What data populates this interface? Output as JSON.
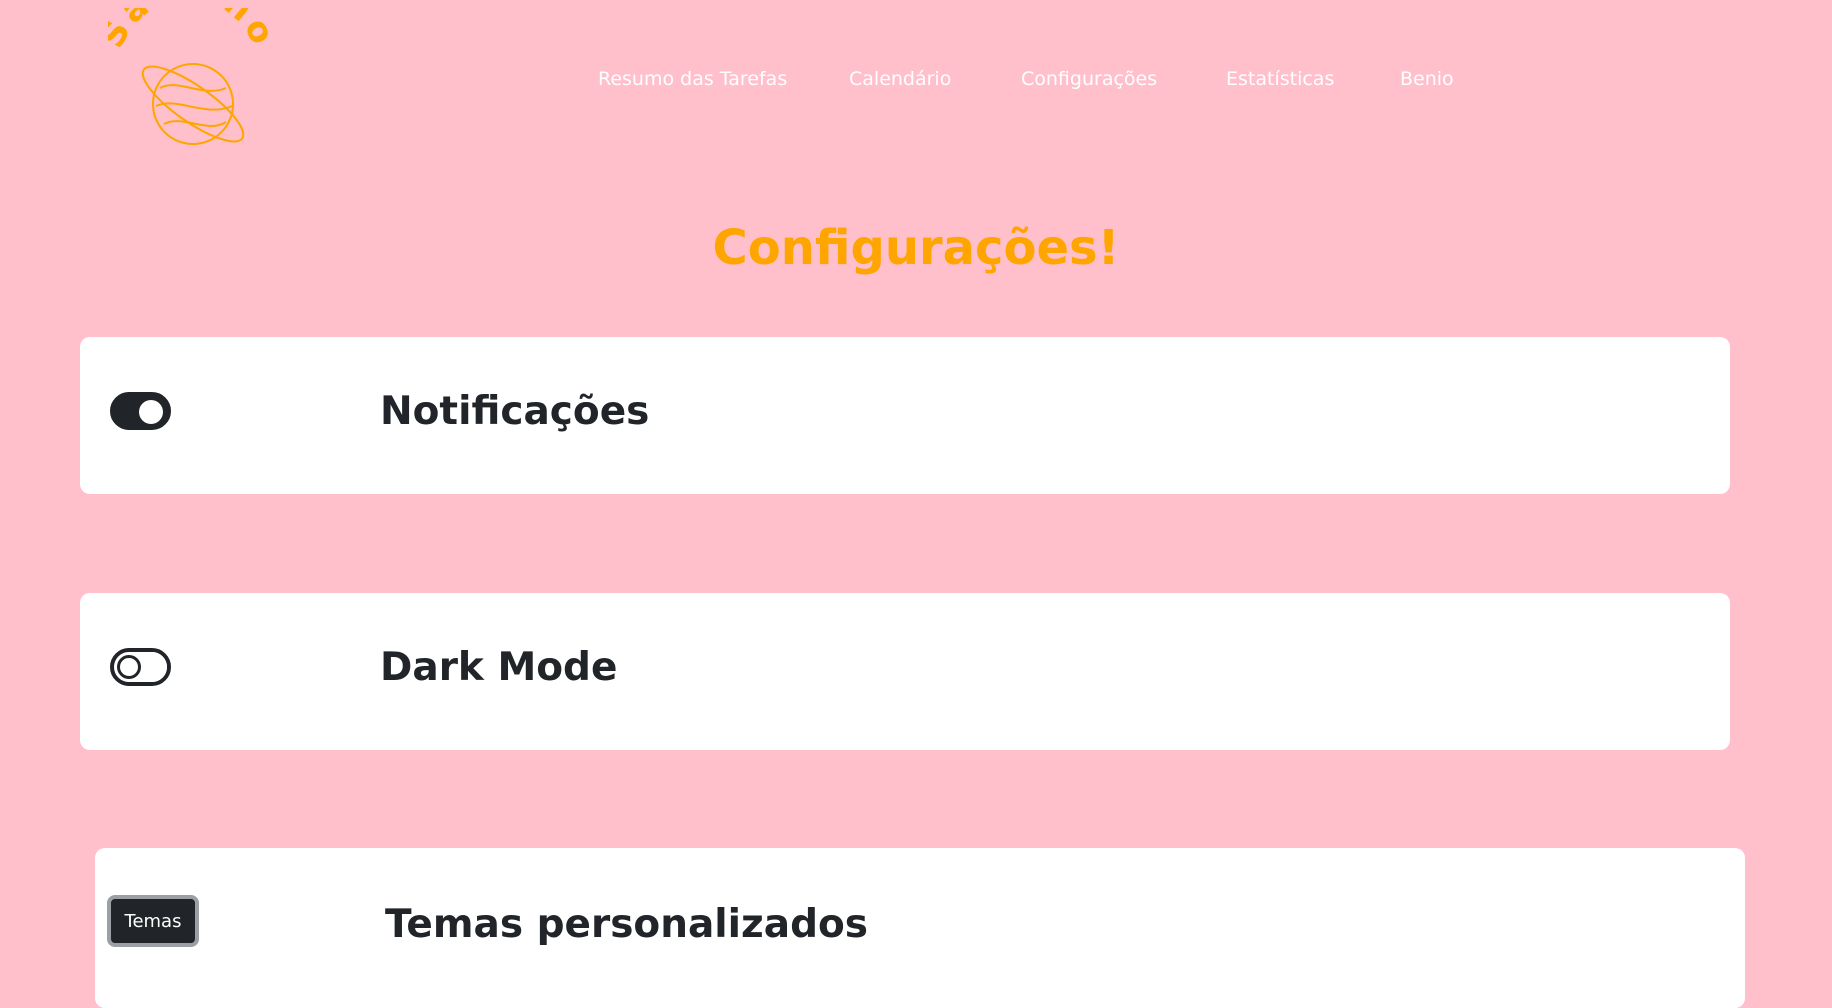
{
  "logo": {
    "text": "Saturno",
    "icon": "saturn-planet-icon",
    "color": "#ffa500"
  },
  "nav": {
    "items": [
      {
        "label": "Resumo das Tarefas"
      },
      {
        "label": "Calendário"
      },
      {
        "label": "Configurações"
      },
      {
        "label": "Estatísticas"
      },
      {
        "label": "Benio"
      }
    ]
  },
  "page": {
    "title": "Configurações!",
    "background": "#ffc0cb",
    "accent": "#ffa500"
  },
  "settings": {
    "notifications": {
      "label": "Notificações",
      "enabled": true
    },
    "dark_mode": {
      "label": "Dark Mode",
      "enabled": false
    },
    "themes": {
      "label": "Temas personalizados",
      "button_label": "Temas"
    }
  }
}
